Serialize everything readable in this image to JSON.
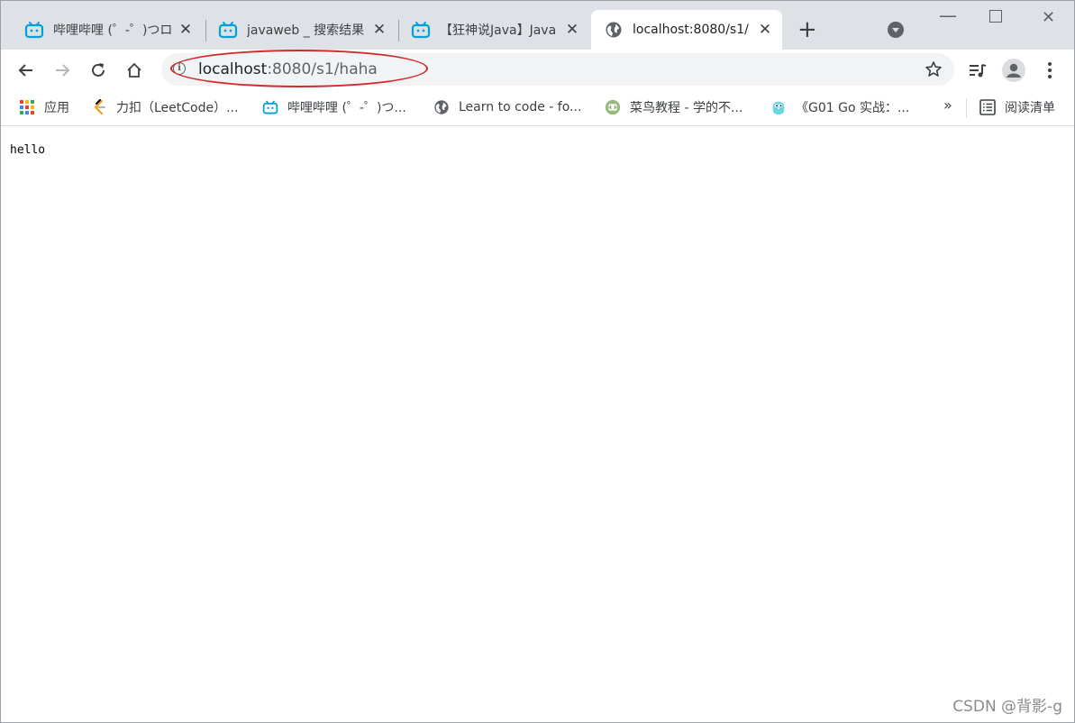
{
  "tabs": [
    {
      "title": "哔哩哔哩 (゜-゜)つロ",
      "icon": "bilibili-icon",
      "active": false
    },
    {
      "title": "javaweb _ 搜索结果",
      "icon": "bilibili-icon",
      "active": false
    },
    {
      "title": "【狂神说Java】Java",
      "icon": "bilibili-icon",
      "active": false
    },
    {
      "title": "localhost:8080/s1/",
      "icon": "globe-icon",
      "active": true
    }
  ],
  "toolbar": {
    "url_host": "localhost",
    "url_rest": ":8080/s1/haha",
    "icons": [
      "back-arrow-icon",
      "forward-arrow-icon",
      "reload-icon",
      "home-icon",
      "bookmark-star-icon",
      "media-controls-icon",
      "profile-avatar-icon",
      "menu-kebab-icon"
    ]
  },
  "bookmarks": [
    {
      "label": "应用",
      "icon": "apps-grid-icon"
    },
    {
      "label": "力扣（LeetCode）...",
      "icon": "leetcode-icon"
    },
    {
      "label": "哔哩哔哩 (゜-゜)つ...",
      "icon": "bilibili-icon"
    },
    {
      "label": "Learn to code - fo...",
      "icon": "globe-icon"
    },
    {
      "label": "菜鸟教程 - 学的不...",
      "icon": "runoob-icon"
    },
    {
      "label": "《G01 Go 实战：...",
      "icon": "gopher-icon"
    }
  ],
  "bookmarks_more": "»",
  "reading_list": {
    "label": "阅读清单",
    "icon": "reading-list-icon"
  },
  "page": {
    "body_text": "hello"
  },
  "watermark": "CSDN @背影-g",
  "colors": {
    "highlight_oval": "#d22b2b",
    "bilibili": "#00a1d6",
    "tabstrip": "#dee1e6"
  }
}
